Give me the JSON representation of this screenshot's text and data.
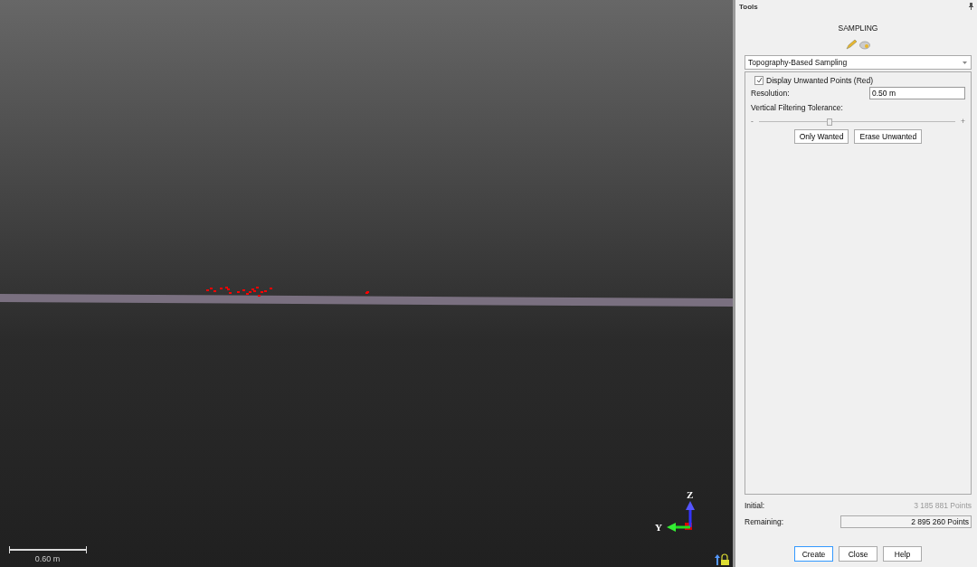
{
  "viewport": {
    "scale_label": "0.60 m",
    "axis_labels": [
      "Z",
      "Y"
    ]
  },
  "tools": {
    "title": "Tools",
    "heading": "SAMPLING",
    "method": "Topography-Based Sampling",
    "display_unwanted": {
      "label": "Display Unwanted Points (Red)",
      "checked": true
    },
    "resolution": {
      "label": "Resolution:",
      "value": "0.50 m"
    },
    "tolerance": {
      "label": "Vertical Filtering Tolerance:",
      "level": 0.36,
      "min_label": "-",
      "max_label": "+"
    },
    "filter_buttons": [
      "Only Wanted",
      "Erase Unwanted"
    ],
    "initial": {
      "label": "Initial:",
      "value": "3 185 881  Points"
    },
    "remaining": {
      "label": "Remaining:",
      "value": "2 895 260  Points"
    },
    "buttons": [
      {
        "label": "Create",
        "default": true
      },
      {
        "label": "Close",
        "default": false
      },
      {
        "label": "Help",
        "default": false
      }
    ]
  }
}
